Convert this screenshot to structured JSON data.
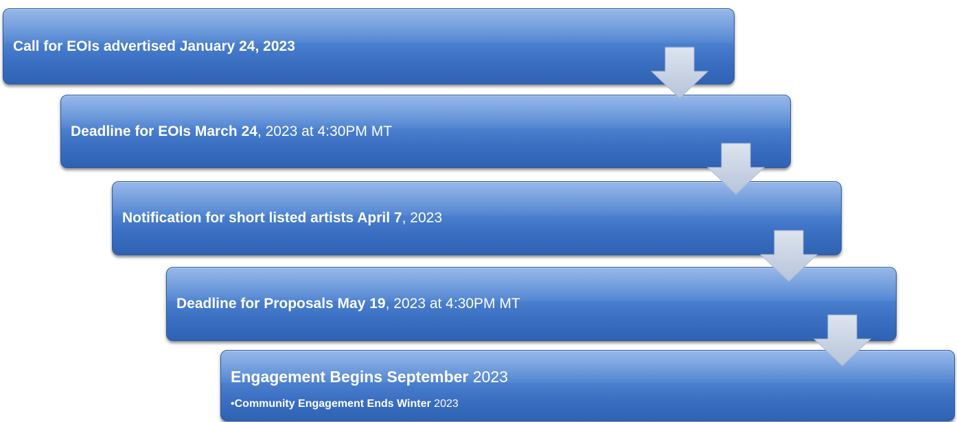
{
  "steps": [
    {
      "bold": "Call for EOIs advertised January 24, 2023",
      "normal": ""
    },
    {
      "bold": "Deadline for EOIs March 24",
      "normal": ", 2023 at 4:30PM MT"
    },
    {
      "bold": "Notification for short listed artists April 7",
      "normal": ", 2023"
    },
    {
      "bold": "Deadline for Proposals May 19",
      "normal": ", 2023 at 4:30PM MT"
    }
  ],
  "final_step": {
    "bold": "Engagement Begins September",
    "normal": " 2023",
    "sub": {
      "bullet": "•",
      "bold": "Community Engagement Ends  Winter",
      "normal": " 2023"
    }
  },
  "colors": {
    "box": "#4a7fcf",
    "arrow": "#c9d4e6"
  }
}
